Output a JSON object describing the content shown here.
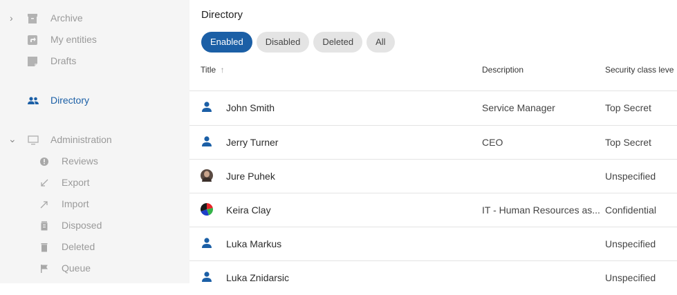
{
  "sidebar": {
    "items": [
      {
        "label": "Archive",
        "icon": "archive-icon",
        "expandable": true
      },
      {
        "label": "My entities",
        "icon": "my-entities-icon"
      },
      {
        "label": "Drafts",
        "icon": "drafts-icon"
      },
      {
        "label": "Directory",
        "icon": "people-icon",
        "active": true
      },
      {
        "label": "Administration",
        "icon": "monitor-icon",
        "expanded": true
      },
      {
        "label": "Reviews",
        "icon": "alert-circle-icon"
      },
      {
        "label": "Export",
        "icon": "arrow-down-left-icon"
      },
      {
        "label": "Import",
        "icon": "arrow-up-right-icon"
      },
      {
        "label": "Disposed",
        "icon": "disposed-bin-icon"
      },
      {
        "label": "Deleted",
        "icon": "trash-icon"
      },
      {
        "label": "Queue",
        "icon": "flag-icon"
      }
    ]
  },
  "main": {
    "title": "Directory",
    "filters": [
      "Enabled",
      "Disabled",
      "Deleted",
      "All"
    ],
    "active_filter": "Enabled",
    "columns": {
      "title": "Title",
      "sort_indicator": "↑",
      "description": "Description",
      "security": "Security class leve"
    },
    "rows": [
      {
        "name": "John Smith",
        "description": "Service Manager",
        "security": "Top Secret",
        "avatar": "person-icon"
      },
      {
        "name": "Jerry Turner",
        "description": "CEO",
        "security": "Top Secret",
        "avatar": "person-icon"
      },
      {
        "name": "Jure Puhek",
        "description": "",
        "security": "Unspecified",
        "avatar": "photo-avatar"
      },
      {
        "name": "Keira Clay",
        "description": "IT - Human Resources as...",
        "security": "Confidential",
        "avatar": "color-wheel-avatar"
      },
      {
        "name": "Luka Markus",
        "description": "",
        "security": "Unspecified",
        "avatar": "person-icon"
      },
      {
        "name": "Luka Znidarsic",
        "description": "",
        "security": "Unspecified",
        "avatar": "person-icon"
      }
    ]
  },
  "colors": {
    "accent": "#1b5fa6",
    "sidebar_bg": "#f5f5f5",
    "chip_bg": "#e4e4e4"
  }
}
